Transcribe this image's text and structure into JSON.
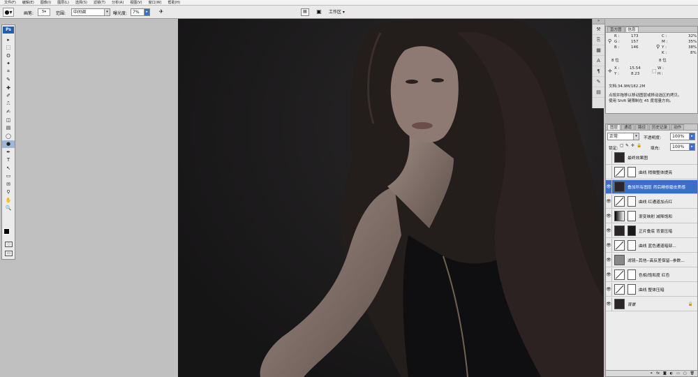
{
  "menu": [
    "文件(F)",
    "编辑(E)",
    "图像(I)",
    "图层(L)",
    "选择(S)",
    "滤镜(T)",
    "分析(A)",
    "视图(V)",
    "窗口(W)",
    "帮助(H)"
  ],
  "options": {
    "brush_label": "画笔:",
    "brush_size": "5",
    "range_label": "范围:",
    "range_value": "中间调",
    "exposure_label": "曝光度:",
    "exposure_value": "7%",
    "workspace_label": "工作区 ▾"
  },
  "toolbox": {
    "logo": "Ps",
    "tools": [
      "move",
      "marquee",
      "lasso",
      "magic-wand",
      "crop",
      "slice",
      "healing",
      "brush",
      "stamp",
      "history-brush",
      "eraser",
      "gradient",
      "blur",
      "dodge",
      "pen",
      "type",
      "path-select",
      "shape",
      "notes",
      "eyedropper",
      "hand",
      "zoom"
    ],
    "tool_glyphs": [
      "▸",
      "⬚",
      "ʘ",
      "✦",
      "⌗",
      "✎",
      "✚",
      "✐",
      "⎍",
      "✍",
      "◫",
      "▤",
      "◯",
      "●",
      "✒",
      "T",
      "↖",
      "▭",
      "✉",
      "⚲",
      "✋",
      "🔍"
    ],
    "selected_tool": "dodge"
  },
  "info_panel": {
    "tabs": [
      "直方图",
      "信息"
    ],
    "active_tab": "信息",
    "r_label": "R :",
    "r": "173",
    "g_label": "G :",
    "g": "157",
    "b_label": "B :",
    "b": "146",
    "c_label": "C :",
    "c": "32%",
    "m_label": "M :",
    "m": "35%",
    "y_label": "Y :",
    "y": "38%",
    "k_label": "K :",
    "k": "8%",
    "bit_left": "8 位",
    "bit_right": "8 位",
    "x_label": "X :",
    "x": "15.54",
    "y2_label": "Y :",
    "y2": "8.23",
    "w_label": "W :",
    "h_label": "H :",
    "doc_info": "文档:34.9M/182.2M",
    "hint_line1": "点按并拖移以移动图层或移动选区的拷贝。",
    "hint_line2": "使用 Shift 键限制在 45 度增量方向。"
  },
  "layers_panel": {
    "tabs": [
      "图层",
      "通道",
      "路径",
      "历史记录",
      "动作"
    ],
    "active_tab": "图层",
    "blend_mode": "正常",
    "opacity_label": "不透明度:",
    "opacity": "100%",
    "lock_label": "锁定:",
    "fill_label": "填充:",
    "fill": "100%",
    "layers": [
      {
        "name": "最终效果图",
        "visible": false,
        "thumb": "img",
        "mask": false,
        "selected": false
      },
      {
        "name": "曲线 稍微整体提亮",
        "visible": false,
        "thumb": "adj",
        "mask": "light",
        "selected": false
      },
      {
        "name": "叠加所有图层 然后精修磨皮质感",
        "visible": true,
        "thumb": "img",
        "mask": false,
        "selected": true
      },
      {
        "name": "曲线 红通道加点红",
        "visible": true,
        "thumb": "adj",
        "mask": "light",
        "selected": false
      },
      {
        "name": "渐变映射 减降饱和",
        "visible": true,
        "thumb": "grad",
        "mask": "light",
        "selected": false
      },
      {
        "name": "正片叠底 背景压暗",
        "visible": true,
        "thumb": "img",
        "mask": "dark",
        "selected": false
      },
      {
        "name": "曲线 蓝色通道暗部...",
        "visible": true,
        "thumb": "adj",
        "mask": "light",
        "selected": false
      },
      {
        "name": "滤镜--其他--高反差保留--参数...",
        "visible": true,
        "thumb": "gray",
        "mask": false,
        "selected": false
      },
      {
        "name": "色相/饱和度 红色",
        "visible": true,
        "thumb": "adj",
        "mask": "light",
        "selected": false
      },
      {
        "name": "曲线 整体压暗",
        "visible": true,
        "thumb": "adj",
        "mask": "light",
        "selected": false
      },
      {
        "name": "背景",
        "visible": true,
        "thumb": "img",
        "mask": false,
        "selected": false,
        "locked": true
      }
    ]
  },
  "colors": {
    "selection": "#3a6fc7",
    "canvas_bg": "#1c1b1c"
  }
}
